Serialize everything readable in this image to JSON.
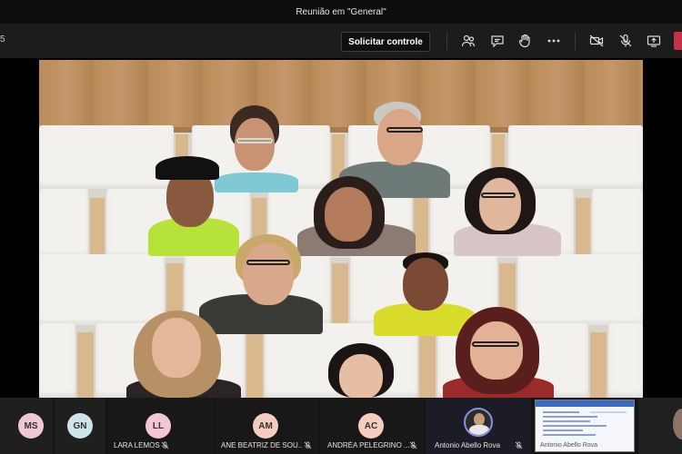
{
  "window": {
    "title": "Reunião em \"General\""
  },
  "toolbar": {
    "timer": "5",
    "request_control_label": "Solicitar controle",
    "icons": [
      "people-icon",
      "chat-icon",
      "raise-hand-icon",
      "more-icon",
      "camera-off-icon",
      "mic-off-icon",
      "share-tray-icon",
      "leave-icon"
    ],
    "leave_color": "#c4314b"
  },
  "participants": [
    {
      "initials": "MS",
      "avatar_color": "#f0c8d4",
      "name": ""
    },
    {
      "initials": "GN",
      "avatar_color": "#cfe3ea",
      "name": ""
    },
    {
      "initials": "LL",
      "avatar_color": "#f3c6d6",
      "name": "LARA LEMOS",
      "muted": true
    },
    {
      "initials": "AM",
      "avatar_color": "#f5cdbf",
      "name": "ANE BEATRIZ DE SOU...",
      "muted": true
    },
    {
      "initials": "AC",
      "avatar_color": "#f5cdbf",
      "name": "ANDRÉA PELEGRINO ...",
      "muted": true
    },
    {
      "initials": "",
      "avatar_color": "#2b2b2b",
      "name": "Antonio Abello Rova",
      "muted": true,
      "photo": true
    }
  ],
  "screen_share": {
    "label": "Antonio Abello Rova"
  }
}
